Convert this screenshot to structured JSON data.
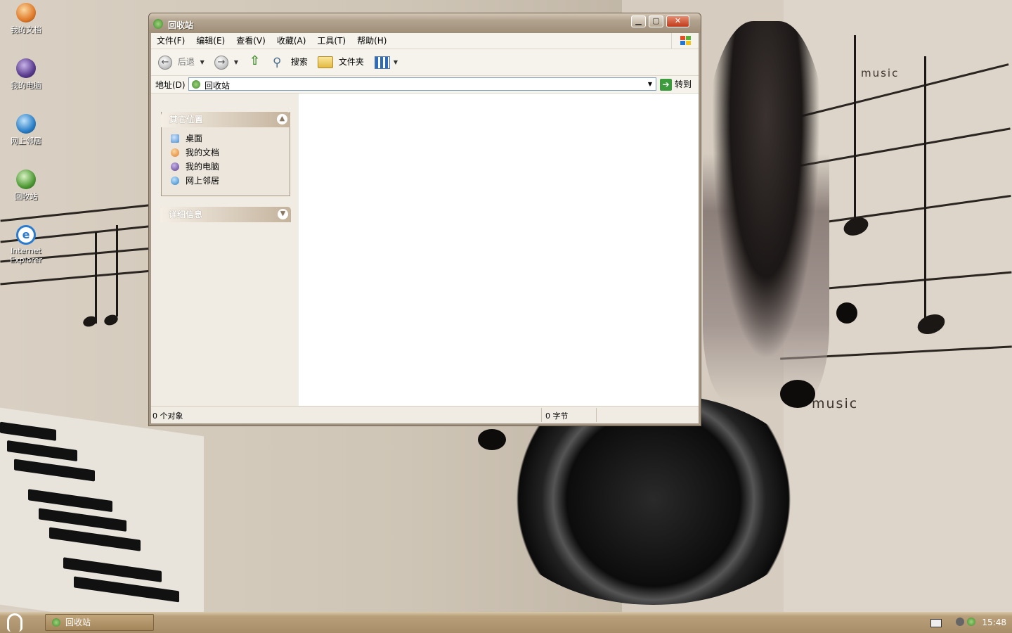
{
  "desktop": {
    "icons": [
      {
        "label": "我的文档",
        "icon": "my-documents-icon",
        "color": "#e07b2a"
      },
      {
        "label": "我的电脑",
        "icon": "my-computer-icon",
        "color": "#5a3b8e"
      },
      {
        "label": "网上邻居",
        "icon": "network-places-icon",
        "color": "#2b7fc7"
      },
      {
        "label": "回收站",
        "icon": "recycle-bin-icon",
        "color": "#4f9a35"
      },
      {
        "label": "Internet Explorer",
        "icon": "internet-explorer-icon",
        "color": "#2a7bd0"
      }
    ],
    "wallpaper_text": [
      "music",
      "music"
    ]
  },
  "window": {
    "title": "回收站",
    "controls": {
      "minimize": "▁",
      "maximize": "▢",
      "close": "✕"
    },
    "menu": [
      "文件(F)",
      "编辑(E)",
      "查看(V)",
      "收藏(A)",
      "工具(T)",
      "帮助(H)"
    ],
    "toolbar": {
      "back": "后退",
      "search": "搜索",
      "folders": "文件夹"
    },
    "address": {
      "label": "地址(D)",
      "value": "回收站",
      "go": "转到"
    },
    "panels": {
      "other_places": {
        "title": "其它位置",
        "links": [
          {
            "label": "桌面",
            "icon": "desktop-icon",
            "color": "#4a8fd6"
          },
          {
            "label": "我的文档",
            "icon": "my-documents-icon",
            "color": "#e07b2a"
          },
          {
            "label": "我的电脑",
            "icon": "my-computer-icon",
            "color": "#5a3b8e"
          },
          {
            "label": "网上邻居",
            "icon": "network-places-icon",
            "color": "#2b7fc7"
          }
        ]
      },
      "details": {
        "title": "详细信息"
      }
    },
    "status": {
      "objects": "0 个对象",
      "size": "0 字节"
    }
  },
  "taskbar": {
    "task": "回收站",
    "clock": "15:48"
  },
  "colors": {
    "titlebar": "#a08f79",
    "taskbar": "#a88e68",
    "accent_green": "#3e8a2a"
  }
}
